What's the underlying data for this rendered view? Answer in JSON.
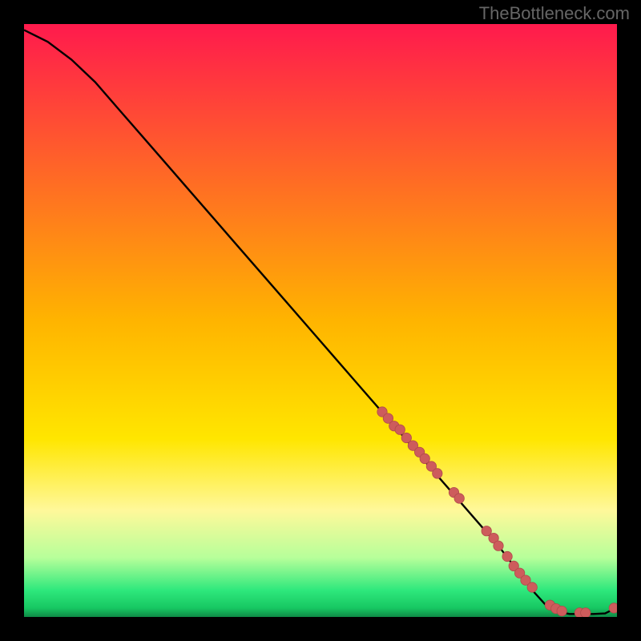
{
  "watermark": "TheBottleneck.com",
  "colors": {
    "page_bg": "#000000",
    "watermark": "#666666",
    "curve": "#000000",
    "dot_fill": "#cd5c5c",
    "dot_stroke": "#b04a4a",
    "gradient_stops": [
      {
        "offset": 0.0,
        "color": "#ff1a4d"
      },
      {
        "offset": 0.5,
        "color": "#ffb400"
      },
      {
        "offset": 0.7,
        "color": "#ffe600"
      },
      {
        "offset": 0.82,
        "color": "#fff89a"
      },
      {
        "offset": 0.9,
        "color": "#b7ff9a"
      },
      {
        "offset": 0.955,
        "color": "#2ee87c"
      },
      {
        "offset": 0.985,
        "color": "#17c762"
      },
      {
        "offset": 1.0,
        "color": "#0f8a46"
      }
    ]
  },
  "chart_data": {
    "type": "line",
    "title": "",
    "xlabel": "",
    "ylabel": "",
    "xlim": [
      0,
      100
    ],
    "ylim": [
      0,
      100
    ],
    "series": [
      {
        "name": "bottleneck-curve",
        "x": [
          0,
          4,
          8,
          12,
          16,
          20,
          24,
          28,
          32,
          36,
          40,
          44,
          48,
          52,
          56,
          60,
          64,
          68,
          72,
          76,
          80,
          82,
          84,
          86,
          88,
          90,
          92,
          94,
          96,
          98,
          100
        ],
        "y": [
          99,
          97,
          94,
          90.2,
          85.6,
          81.0,
          76.4,
          71.8,
          67.2,
          62.6,
          58.0,
          53.4,
          48.8,
          44.2,
          39.6,
          35.0,
          30.4,
          25.8,
          21.2,
          16.6,
          12.0,
          9.4,
          6.8,
          4.2,
          2.0,
          0.9,
          0.5,
          0.5,
          0.5,
          0.6,
          1.6
        ]
      }
    ],
    "highlight_points": {
      "name": "dots",
      "x": [
        60.4,
        61.4,
        62.4,
        63.4,
        64.5,
        65.6,
        66.7,
        67.6,
        68.7,
        69.7,
        72.5,
        73.4,
        78.0,
        79.2,
        80.0,
        81.5,
        82.6,
        83.6,
        84.6,
        85.7,
        88.7,
        89.7,
        90.7,
        93.7,
        94.7,
        99.5
      ],
      "y": [
        34.6,
        33.5,
        32.2,
        31.6,
        30.2,
        28.9,
        27.8,
        26.7,
        25.4,
        24.2,
        21.0,
        20.0,
        14.5,
        13.3,
        12.0,
        10.2,
        8.6,
        7.4,
        6.2,
        5.0,
        2.0,
        1.4,
        1.0,
        0.7,
        0.7,
        1.5
      ]
    }
  }
}
